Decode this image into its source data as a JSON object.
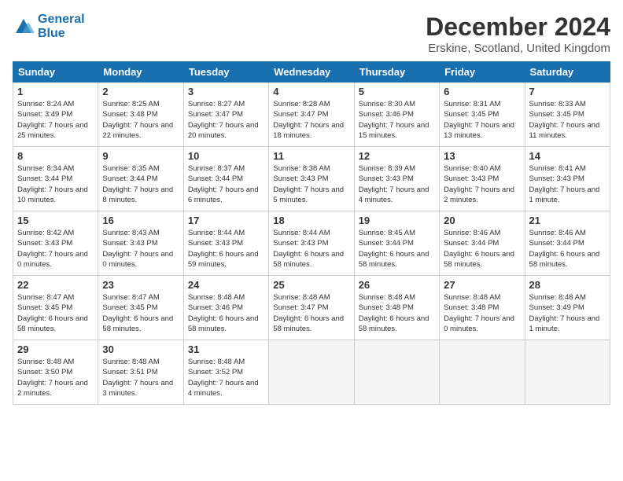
{
  "header": {
    "logo_line1": "General",
    "logo_line2": "Blue",
    "month_title": "December 2024",
    "location": "Erskine, Scotland, United Kingdom"
  },
  "columns": [
    "Sunday",
    "Monday",
    "Tuesday",
    "Wednesday",
    "Thursday",
    "Friday",
    "Saturday"
  ],
  "weeks": [
    [
      {
        "day": "1",
        "rise": "8:24 AM",
        "set": "3:49 PM",
        "daylight": "7 hours and 25 minutes."
      },
      {
        "day": "2",
        "rise": "8:25 AM",
        "set": "3:48 PM",
        "daylight": "7 hours and 22 minutes."
      },
      {
        "day": "3",
        "rise": "8:27 AM",
        "set": "3:47 PM",
        "daylight": "7 hours and 20 minutes."
      },
      {
        "day": "4",
        "rise": "8:28 AM",
        "set": "3:47 PM",
        "daylight": "7 hours and 18 minutes."
      },
      {
        "day": "5",
        "rise": "8:30 AM",
        "set": "3:46 PM",
        "daylight": "7 hours and 15 minutes."
      },
      {
        "day": "6",
        "rise": "8:31 AM",
        "set": "3:45 PM",
        "daylight": "7 hours and 13 minutes."
      },
      {
        "day": "7",
        "rise": "8:33 AM",
        "set": "3:45 PM",
        "daylight": "7 hours and 11 minutes."
      }
    ],
    [
      {
        "day": "8",
        "rise": "8:34 AM",
        "set": "3:44 PM",
        "daylight": "7 hours and 10 minutes."
      },
      {
        "day": "9",
        "rise": "8:35 AM",
        "set": "3:44 PM",
        "daylight": "7 hours and 8 minutes."
      },
      {
        "day": "10",
        "rise": "8:37 AM",
        "set": "3:44 PM",
        "daylight": "7 hours and 6 minutes."
      },
      {
        "day": "11",
        "rise": "8:38 AM",
        "set": "3:43 PM",
        "daylight": "7 hours and 5 minutes."
      },
      {
        "day": "12",
        "rise": "8:39 AM",
        "set": "3:43 PM",
        "daylight": "7 hours and 4 minutes."
      },
      {
        "day": "13",
        "rise": "8:40 AM",
        "set": "3:43 PM",
        "daylight": "7 hours and 2 minutes."
      },
      {
        "day": "14",
        "rise": "8:41 AM",
        "set": "3:43 PM",
        "daylight": "7 hours and 1 minute."
      }
    ],
    [
      {
        "day": "15",
        "rise": "8:42 AM",
        "set": "3:43 PM",
        "daylight": "7 hours and 0 minutes."
      },
      {
        "day": "16",
        "rise": "8:43 AM",
        "set": "3:43 PM",
        "daylight": "7 hours and 0 minutes."
      },
      {
        "day": "17",
        "rise": "8:44 AM",
        "set": "3:43 PM",
        "daylight": "6 hours and 59 minutes."
      },
      {
        "day": "18",
        "rise": "8:44 AM",
        "set": "3:43 PM",
        "daylight": "6 hours and 58 minutes."
      },
      {
        "day": "19",
        "rise": "8:45 AM",
        "set": "3:44 PM",
        "daylight": "6 hours and 58 minutes."
      },
      {
        "day": "20",
        "rise": "8:46 AM",
        "set": "3:44 PM",
        "daylight": "6 hours and 58 minutes."
      },
      {
        "day": "21",
        "rise": "8:46 AM",
        "set": "3:44 PM",
        "daylight": "6 hours and 58 minutes."
      }
    ],
    [
      {
        "day": "22",
        "rise": "8:47 AM",
        "set": "3:45 PM",
        "daylight": "6 hours and 58 minutes."
      },
      {
        "day": "23",
        "rise": "8:47 AM",
        "set": "3:45 PM",
        "daylight": "6 hours and 58 minutes."
      },
      {
        "day": "24",
        "rise": "8:48 AM",
        "set": "3:46 PM",
        "daylight": "6 hours and 58 minutes."
      },
      {
        "day": "25",
        "rise": "8:48 AM",
        "set": "3:47 PM",
        "daylight": "6 hours and 58 minutes."
      },
      {
        "day": "26",
        "rise": "8:48 AM",
        "set": "3:48 PM",
        "daylight": "6 hours and 58 minutes."
      },
      {
        "day": "27",
        "rise": "8:48 AM",
        "set": "3:48 PM",
        "daylight": "7 hours and 0 minutes."
      },
      {
        "day": "28",
        "rise": "8:48 AM",
        "set": "3:49 PM",
        "daylight": "7 hours and 1 minute."
      }
    ],
    [
      {
        "day": "29",
        "rise": "8:48 AM",
        "set": "3:50 PM",
        "daylight": "7 hours and 2 minutes."
      },
      {
        "day": "30",
        "rise": "8:48 AM",
        "set": "3:51 PM",
        "daylight": "7 hours and 3 minutes."
      },
      {
        "day": "31",
        "rise": "8:48 AM",
        "set": "3:52 PM",
        "daylight": "7 hours and 4 minutes."
      },
      null,
      null,
      null,
      null
    ]
  ]
}
